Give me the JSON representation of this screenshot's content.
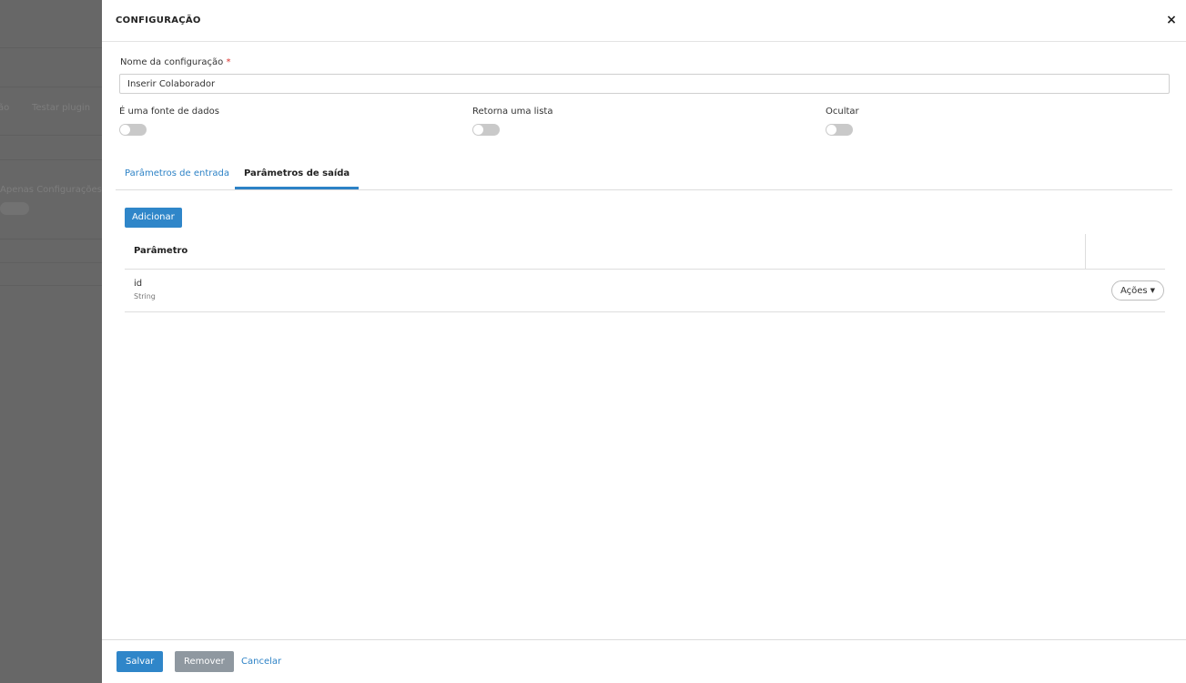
{
  "backdrop": {
    "text_1": "ão",
    "text_2": "Testar plugin",
    "text_3": "Apenas Configurações"
  },
  "panel": {
    "title": "CONFIGURAÇÃO",
    "close_label": "×"
  },
  "form": {
    "name_label": "Nome da configuração",
    "required_mark": "*",
    "name_value": "Inserir Colaborador",
    "toggles": [
      {
        "label": "É uma fonte de dados",
        "checked": false
      },
      {
        "label": "Retorna uma lista",
        "checked": false
      },
      {
        "label": "Ocultar",
        "checked": false
      }
    ]
  },
  "tabs": [
    {
      "label": "Parâmetros de entrada",
      "active": false
    },
    {
      "label": "Parâmetros de saída",
      "active": true
    }
  ],
  "add_button_label": "Adicionar",
  "table": {
    "column_header": "Parâmetro",
    "rows": [
      {
        "name": "id",
        "type": "String",
        "actions_label": "Ações"
      }
    ]
  },
  "footer": {
    "save_label": "Salvar",
    "remove_label": "Remover",
    "cancel_label": "Cancelar"
  },
  "colors": {
    "primary": "#2f86c9",
    "link": "#2d82c6",
    "remove_button": "#8f98a0",
    "required": "#d9302c",
    "backdrop": "#676767"
  },
  "icons": {
    "close": "close-icon",
    "actions_caret": "caret-down-icon"
  }
}
